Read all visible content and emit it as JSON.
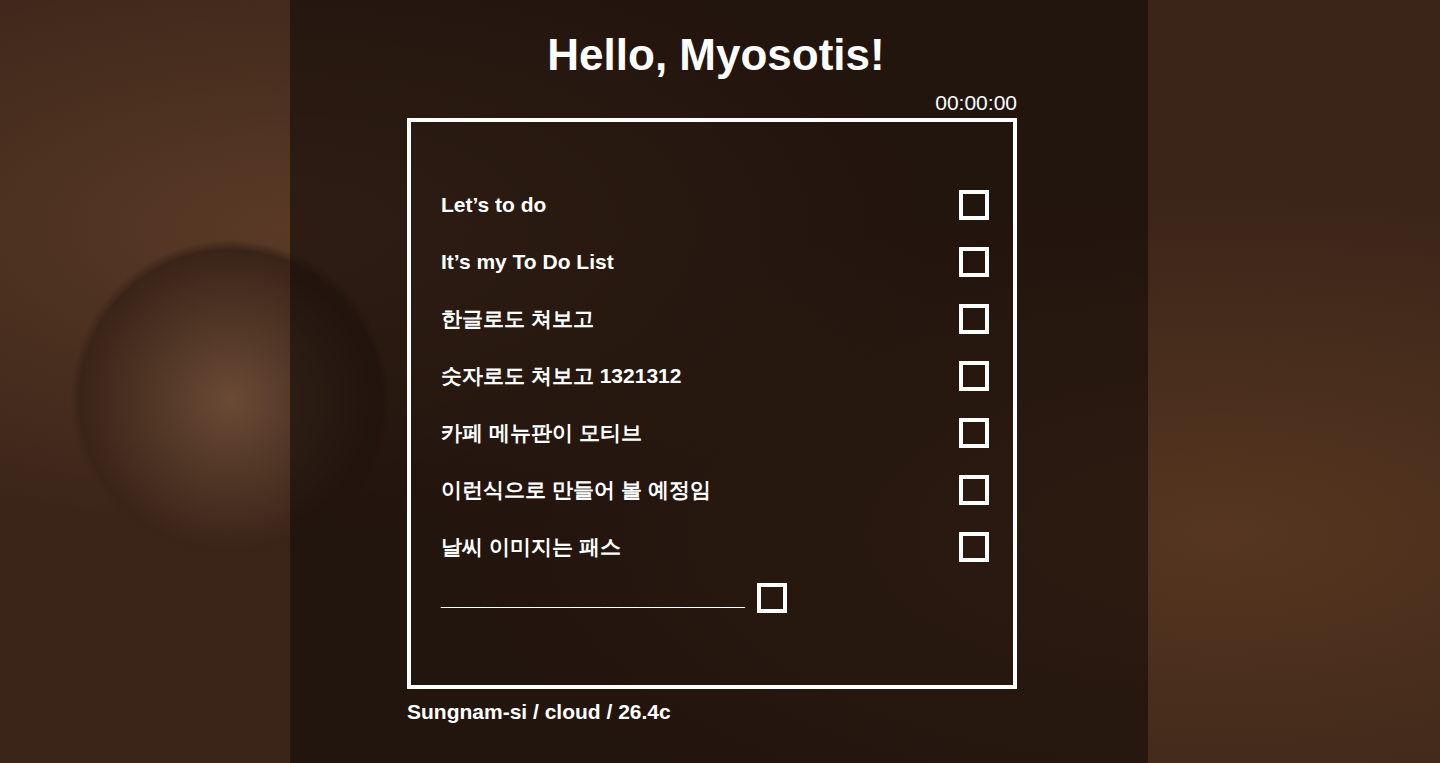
{
  "greeting": "Hello, Myosotis!",
  "clock": "00:00:00",
  "todos": [
    {
      "text": "Let’s to do",
      "checked": false
    },
    {
      "text": "It’s my To Do List",
      "checked": false
    },
    {
      "text": "한글로도 쳐보고",
      "checked": false
    },
    {
      "text": "숫자로도 쳐보고 1321312",
      "checked": false
    },
    {
      "text": "카페 메뉴판이 모티브",
      "checked": false
    },
    {
      "text": "이런식으로 만들어 볼 예정임",
      "checked": false
    },
    {
      "text": "날씨 이미지는 패스",
      "checked": false
    }
  ],
  "new_item": {
    "text": "__________________________",
    "checked": false
  },
  "weather": "Sungnam-si / cloud / 26.4c"
}
